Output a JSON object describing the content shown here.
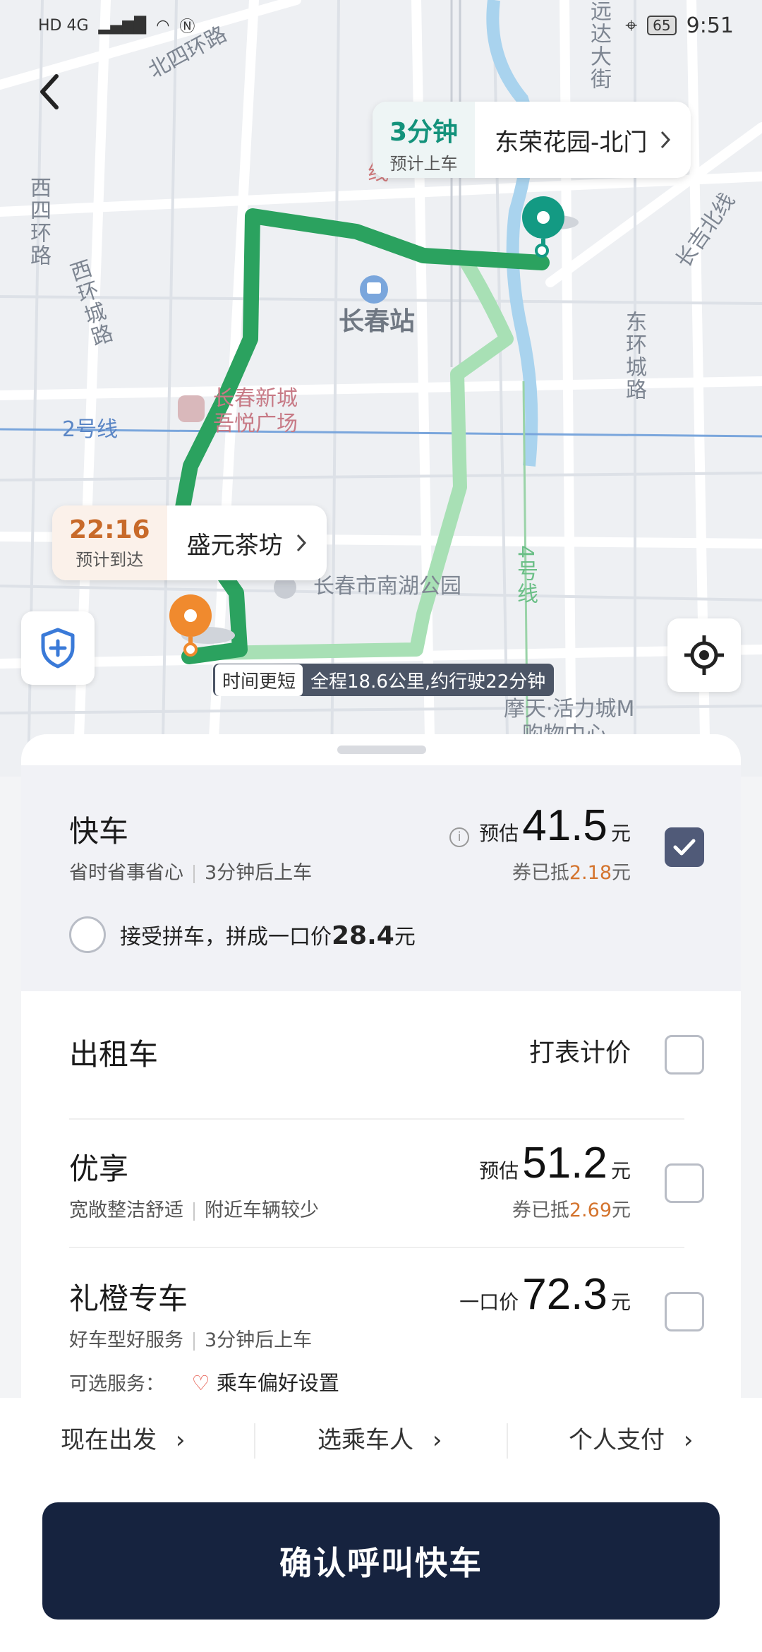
{
  "status_bar": {
    "left": "HD 4G",
    "battery": "65",
    "time": "9:51"
  },
  "map": {
    "labels": {
      "north_ring": "北四环路",
      "west_ring_road": "西四环路",
      "west_ring_city": "西环城路",
      "east_ring_city": "东环城路",
      "changji": "长吉北线",
      "street_top": "远达大街",
      "station": "长春站",
      "xincheng": "长春新城",
      "xincheng2": "吾悦广场",
      "line2": "2号线",
      "line4": "4号线",
      "nanhu": "长春市南湖公园",
      "motian": "摩天·活力城M",
      "motian2": "购物中心",
      "line_red": "线"
    },
    "pickup": {
      "eta": "3分钟",
      "eta_label": "预计上车",
      "name": "东荣花园-北门"
    },
    "dropoff": {
      "eta": "22:16",
      "eta_label": "预计到达",
      "name": "盛元茶坊"
    },
    "route": {
      "tag": "时间更短",
      "summary": "全程18.6公里,约行驶22分钟"
    }
  },
  "options": [
    {
      "title": "快车",
      "sub1": "省时省事省心",
      "sub2": "3分钟后上车",
      "price_prefix": "预估",
      "price": "41.5",
      "unit": "元",
      "coupon_prefix": "券已抵",
      "coupon_amount": "2.18",
      "coupon_unit": "元",
      "checked": true,
      "carpool_prefix": "接受拼车，拼成一口价",
      "carpool_price": "28.4",
      "carpool_unit": "元"
    },
    {
      "title": "出租车",
      "price_text": "打表计价",
      "checked": false
    },
    {
      "title": "优享",
      "sub1": "宽敞整洁舒适",
      "sub2": "附近车辆较少",
      "price_prefix": "预估",
      "price": "51.2",
      "unit": "元",
      "coupon_prefix": "券已抵",
      "coupon_amount": "2.69",
      "coupon_unit": "元",
      "checked": false
    },
    {
      "title": "礼橙专车",
      "sub1": "好车型好服务",
      "sub2": "3分钟后上车",
      "price_prefix": "一口价",
      "price": "72.3",
      "unit": "元",
      "services_label": "可选服务：",
      "services_link": "乘车偏好设置",
      "checked": false
    }
  ],
  "footer": {
    "depart": "现在出发",
    "passenger": "选乘车人",
    "payment": "个人支付",
    "confirm": "确认呼叫快车"
  }
}
